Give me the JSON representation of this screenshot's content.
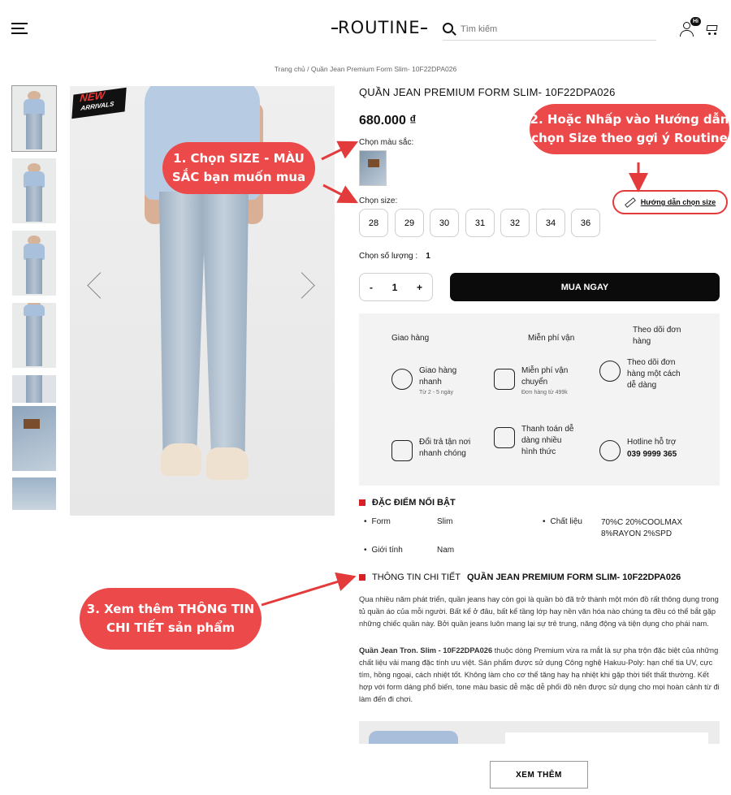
{
  "header": {
    "logo": "ROUTINE",
    "search_placeholder": "Tìm kiếm",
    "user_badge": "Hi"
  },
  "breadcrumb": "Trang chủ / Quần Jean Premium Form Slim- 10F22DPA026",
  "product": {
    "title": "QUẦN JEAN PREMIUM FORM SLIM- 10F22DPA026",
    "price": "680.000 ₫",
    "color_label": "Chọn màu sắc:",
    "size_label": "Chọn size:",
    "sizes": [
      "28",
      "29",
      "30",
      "31",
      "32",
      "34",
      "36"
    ],
    "size_guide": "Hướng dẫn chọn size",
    "quantity_label": "Chọn số lượng :",
    "quantity_value": "1",
    "qty_input": "1",
    "minus": "-",
    "plus": "+",
    "buy_now": "MUA NGAY"
  },
  "badge": {
    "new": "NEW",
    "arrivals": "ARRIVALS"
  },
  "services_strip": [
    {
      "title": "Giao hàng"
    },
    {
      "title": "Miễn phí vận"
    },
    {
      "title": "Theo dõi đơn hàng"
    }
  ],
  "services": [
    {
      "title": "Giao hàng nhanh",
      "sub": "Từ 2 - 5 ngày",
      "icon": "fast-delivery-icon"
    },
    {
      "title": "Miễn phí vận chuyển",
      "sub": "Đơn hàng từ 499k",
      "icon": "free-shipping-icon"
    },
    {
      "title": "Theo dõi đơn hàng một cách dễ dàng",
      "sub": "",
      "icon": "tracking-icon"
    },
    {
      "title": "Đổi trả tận nơi nhanh chóng",
      "sub": "",
      "icon": "return-icon"
    },
    {
      "title": "Thanh toán dễ dàng nhiều hình thức",
      "sub": "",
      "icon": "wallet-icon"
    },
    {
      "title": "Hotline hỗ trợ",
      "sub": "039 9999 365",
      "icon": "headset-icon"
    }
  ],
  "features": {
    "heading": "ĐẶC ĐIỂM NỔI BẬT",
    "items": [
      {
        "name": "Form",
        "value": "Slim"
      },
      {
        "name": "Chất liệu",
        "value": "70%C 20%COOLMAX 8%RAYON 2%SPD"
      },
      {
        "name": "Giới tính",
        "value": "Nam"
      }
    ]
  },
  "details": {
    "heading_prefix": "THÔNG TIN CHI TIẾT",
    "heading_bold": "QUẦN JEAN PREMIUM FORM SLIM- 10F22DPA026",
    "para1": "Qua nhiều năm phát triển, quần jeans hay còn gọi là quần bò đã trở thành một món đồ rất thông dụng trong tủ quần áo của mỗi người. Bất kể ở đâu, bất kể tầng lớp hay nền văn hóa nào chúng ta đều có thể bắt gặp những chiếc quần này. Bởi quần jeans luôn mang lại sự trẻ trung, năng động và tiện dụng cho phái nam.",
    "para2_bold": "Quần Jean Tron. Slim - 10F22DPA026",
    "para2": " thuộc dòng Premium vừa ra mắt là sự pha trộn đặc biệt của những chất liệu vải mang đặc tính ưu việt. Sản phẩm được sử dụng Công nghệ Hakuu-Poly: hạn chế tia UV, cực tím, hồng ngoại, cách nhiệt tốt. Không làm cho cơ thể tăng hay hạ nhiệt khi gặp thời tiết thất thường. Kết hợp với form dáng phổ biến, tone màu basic dễ mặc dễ phối đồ nên được sử dụng cho mọi hoàn cảnh từ đi làm đến đi chơi."
  },
  "more_button": "XEM THÊM",
  "annotations": {
    "step1_line1": "1. Chọn SIZE - MÀU",
    "step1_line2": "SẮC bạn muốn mua",
    "step2_line1": "2. Hoặc Nhấp vào Hướng dẫn",
    "step2_line2": "chọn Size theo gợi ý Routine",
    "step3_line1": "3. Xem thêm THÔNG TIN",
    "step3_line2": "CHI TIẾT sản phẩm"
  },
  "colors": {
    "accent_red": "#ec4a4a",
    "primary_button": "#0b0b0b",
    "section_marker": "#d81f26"
  }
}
